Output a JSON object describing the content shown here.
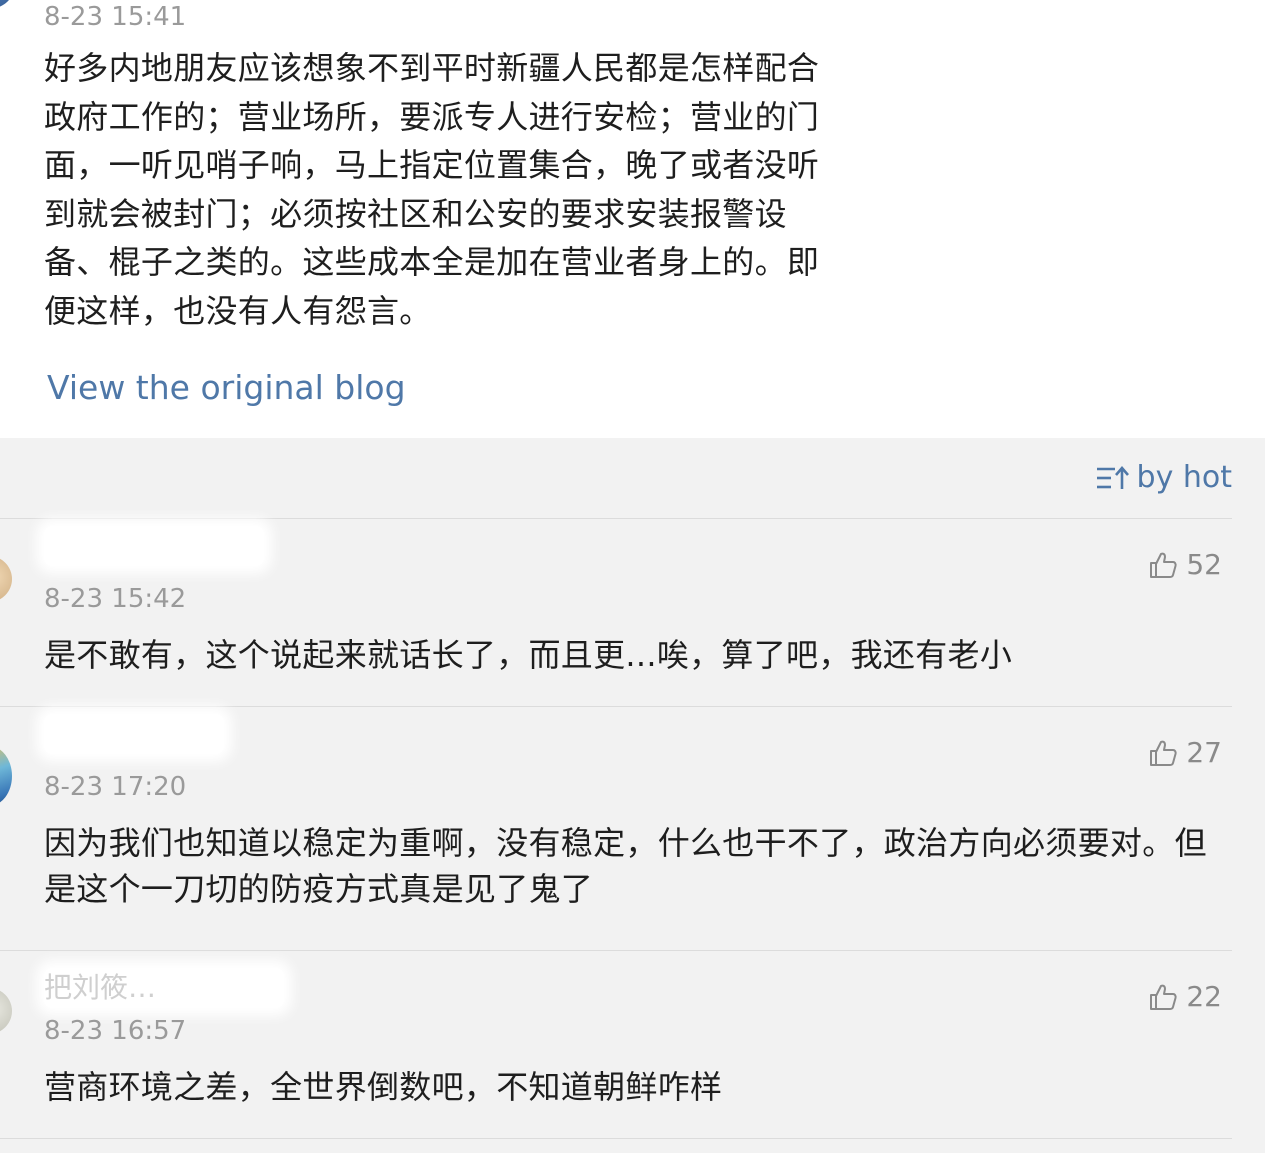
{
  "post": {
    "time": "8-23 15:41",
    "body": "好多内地朋友应该想象不到平时新疆人民都是怎样配合\n政府工作的；营业场所，要派专人进行安检；营业的门\n面，一听见哨子响，马上指定位置集合，晚了或者没听\n到就会被封门；必须按社区和公安的要求安装报警设\n备、棍子之类的。这些成本全是加在营业者身上的。即\n便这样，也没有人有怨言。",
    "view_original": "View the original blog"
  },
  "sort": {
    "label": "by hot",
    "icon": "sort-icon"
  },
  "comments": [
    {
      "name": "",
      "time": "8-23 15:42",
      "likes": "52",
      "text": "是不敢有，这个说起来就话长了，而且更...唉，算了吧，我还有老小"
    },
    {
      "name": "",
      "time": "8-23 17:20",
      "likes": "27",
      "text": "因为我们也知道以稳定为重啊，没有稳定，什么也干不了，政治方向必须要对。但是这个一刀切的防疫方式真是见了鬼了"
    },
    {
      "name": "把刘筱…",
      "time": "8-23 16:57",
      "likes": "22",
      "text": "营商环境之差，全世界倒数吧，不知道朝鲜咋样"
    }
  ],
  "colors": {
    "link": "#4f78a8",
    "muted": "#9a9a9a",
    "text": "#1e1e1e",
    "background": "#f2f2f2"
  }
}
